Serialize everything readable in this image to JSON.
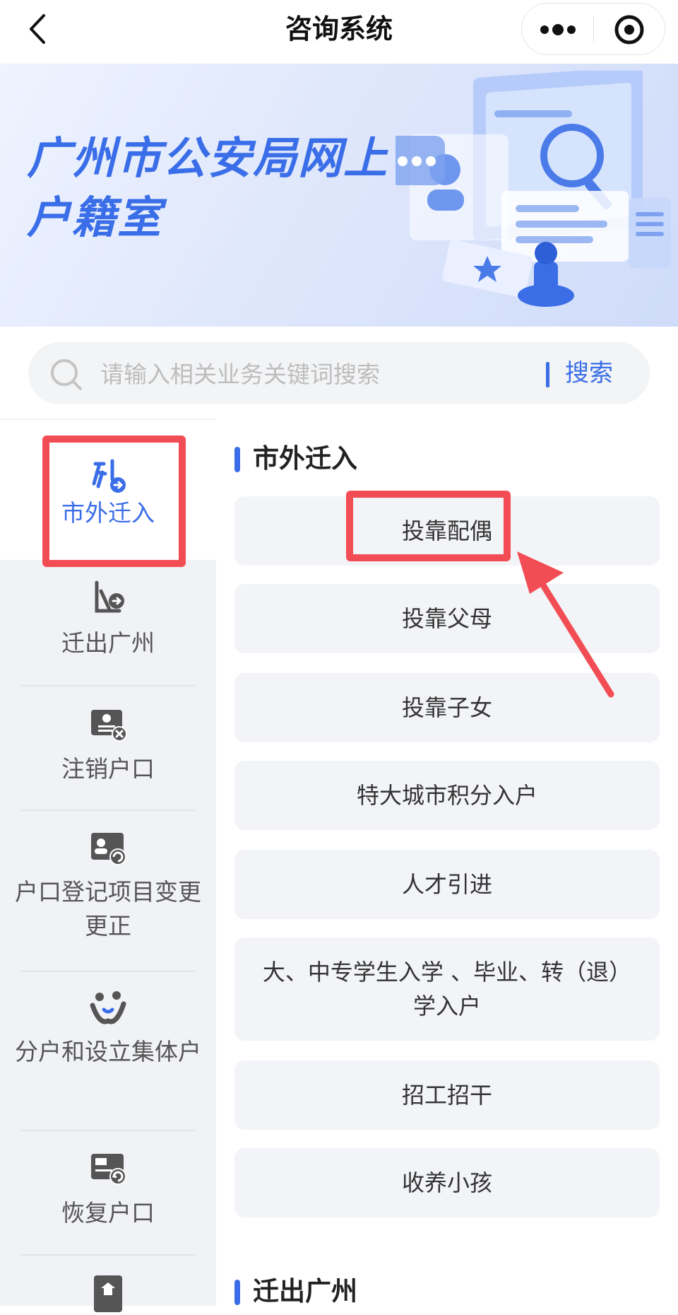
{
  "header": {
    "title": "咨询系统"
  },
  "banner": {
    "title": "广州市公安局网上户籍室"
  },
  "search": {
    "placeholder": "请输入相关业务关键词搜索",
    "button_label": "搜索"
  },
  "sidebar": {
    "items": [
      {
        "label": "市外迁入",
        "icon": "move-in-icon",
        "active": true
      },
      {
        "label": "迁出广州",
        "icon": "move-out-icon"
      },
      {
        "label": "注销户口",
        "icon": "cancel-registration-icon"
      },
      {
        "label": "户口登记项目变更更正",
        "icon": "change-registration-icon"
      },
      {
        "label": "分户和设立集体户",
        "icon": "split-household-icon"
      },
      {
        "label": "恢复户口",
        "icon": "restore-registration-icon"
      },
      {
        "label": "",
        "icon": "household-icon"
      }
    ]
  },
  "content": {
    "sections": [
      {
        "title": "市外迁入",
        "options": [
          "投靠配偶",
          "投靠父母",
          "投靠子女",
          "特大城市积分入户",
          "人才引进",
          "大、中专学生入学 、毕业、转（退）学入户",
          "招工招干",
          "收养小孩"
        ]
      },
      {
        "title": "迁出广州",
        "options": []
      }
    ]
  },
  "colors": {
    "accent": "#3a6ee8",
    "highlight": "#f24d55",
    "sidebar_bg": "#f1f2f6",
    "option_bg": "#f3f4f7"
  }
}
